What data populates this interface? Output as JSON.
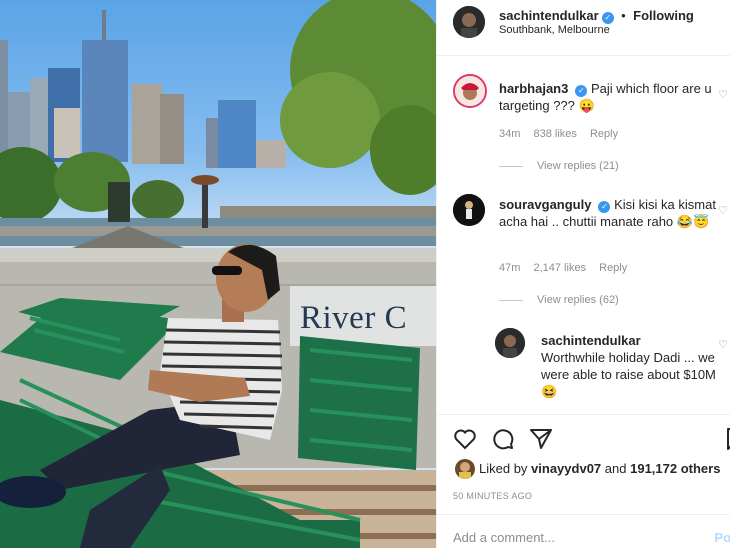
{
  "post": {
    "author": "sachintendulkar",
    "follow_dot": "•",
    "follow_state": "Following",
    "location": "Southbank, Melbourne",
    "sign_text": "River C"
  },
  "comments": [
    {
      "user": "harbhajan3",
      "text": "Paji which floor are u targeting ??? 😛",
      "time": "34m",
      "likes": "838 likes",
      "reply": "Reply",
      "view_replies": "View replies (21)"
    },
    {
      "user": "souravganguly",
      "text": "Kisi kisi ka kismat acha hai .. chuttii manate raho 😂😇",
      "time": "47m",
      "likes": "2,147 likes",
      "reply": "Reply",
      "view_replies": "View replies (62)"
    }
  ],
  "reply": {
    "user": "sachintendulkar",
    "text": "Worthwhile holiday Dadi ... we were able to raise about $10M 😆"
  },
  "actions": {
    "icons": [
      "heart-icon",
      "comment-icon",
      "share-icon",
      "bookmark-icon"
    ],
    "liked_by_label": "Liked by",
    "liked_by_user": "vinayydv07",
    "and_label": "and",
    "others_count": "191,172 others",
    "timestamp": "50 MINUTES AGO"
  },
  "add_comment": {
    "placeholder": "Add a comment...",
    "post_label": "Po"
  },
  "colors": {
    "verified": "#3897f0",
    "bench": "#1f7a4c",
    "sky": "#7fb6ea"
  }
}
